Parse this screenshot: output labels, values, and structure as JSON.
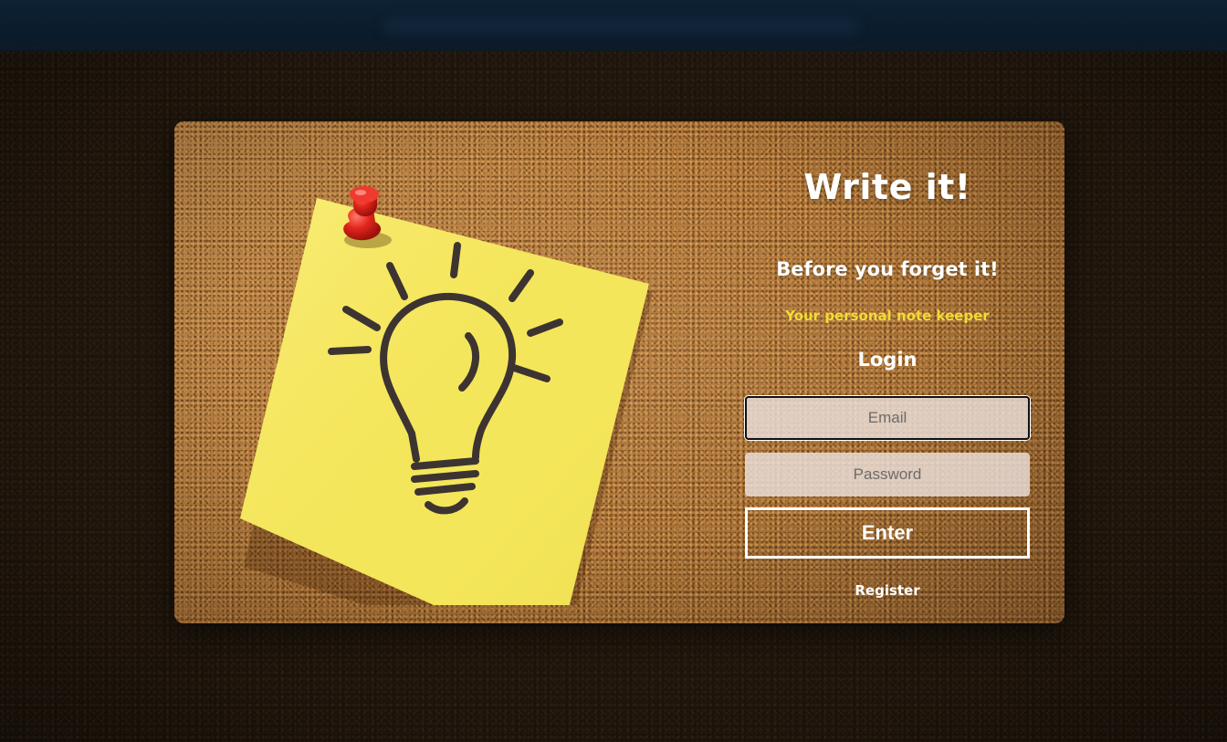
{
  "app": {
    "title": "Write it!",
    "tagline": "Before you forget it!",
    "subtitle": "Your personal note keeper"
  },
  "login": {
    "heading": "Login",
    "email_placeholder": "Email",
    "password_placeholder": "Password",
    "enter_label": "Enter",
    "register_label": "Register"
  },
  "illustration": {
    "icons": [
      "sticky-note-icon",
      "pushpin-icon",
      "lightbulb-icon"
    ]
  },
  "colors": {
    "note_yellow": "#f5e95a",
    "pin_red": "#e3261d",
    "subtitle_yellow": "#f2dc35",
    "topbar_navy": "#0d2135",
    "cork_brown": "#b47a3c"
  }
}
